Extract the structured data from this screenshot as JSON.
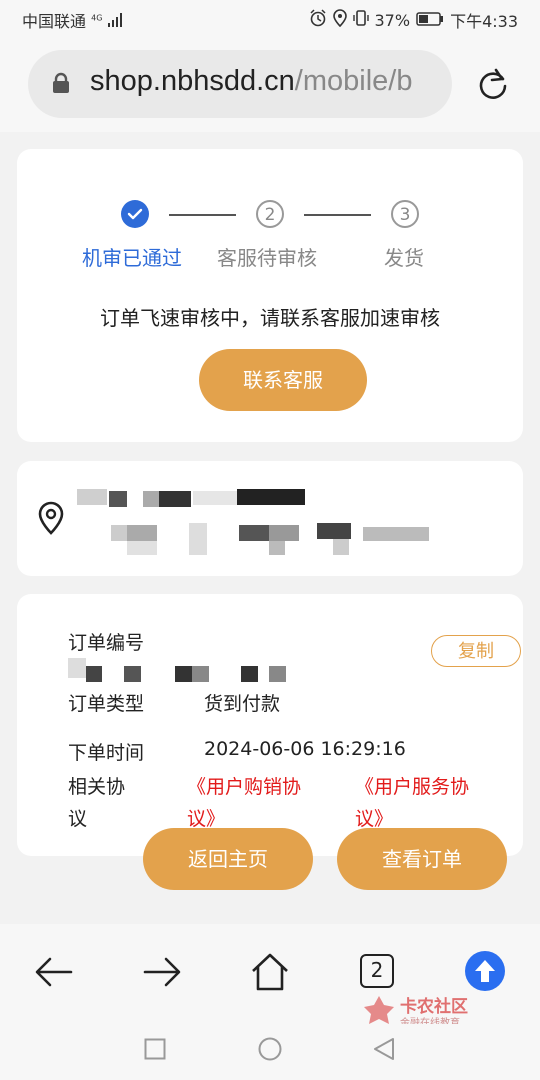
{
  "status_bar": {
    "carrier": "中国联通",
    "network": "4G",
    "battery": "37%",
    "time": "下午4:33"
  },
  "browser": {
    "url_host": "shop.nbhsdd.cn",
    "url_path": "/mobile/b",
    "tab_count": "2"
  },
  "progress": {
    "steps": [
      {
        "label": "机审已通过",
        "number": "1",
        "state": "done"
      },
      {
        "label": "客服待审核",
        "number": "2",
        "state": "todo"
      },
      {
        "label": "发货",
        "number": "3",
        "state": "todo"
      }
    ],
    "message": "订单飞速审核中，请联系客服加速审核",
    "contact_button": "联系客服"
  },
  "order": {
    "number_label": "订单编号",
    "copy_button": "复制",
    "type_label": "订单类型",
    "type_value": "货到付款",
    "time_label": "下单时间",
    "time_value": "2024-06-06 16:29:16",
    "agreement_label_1": "相关协",
    "agreement_label_2": "议",
    "agreement_1_line1": "《用户购销协",
    "agreement_1_line2": "议》",
    "agreement_2_line1": "《用户服务协",
    "agreement_2_line2": "议》"
  },
  "actions": {
    "home_button": "返回主页",
    "view_order_button": "查看订单"
  },
  "watermark": {
    "title": "卡农社区",
    "subtitle": "金融在线教育"
  },
  "colors": {
    "accent_blue": "#2e6bd8",
    "gold": "#e3a24c",
    "red": "#e21b1b"
  }
}
